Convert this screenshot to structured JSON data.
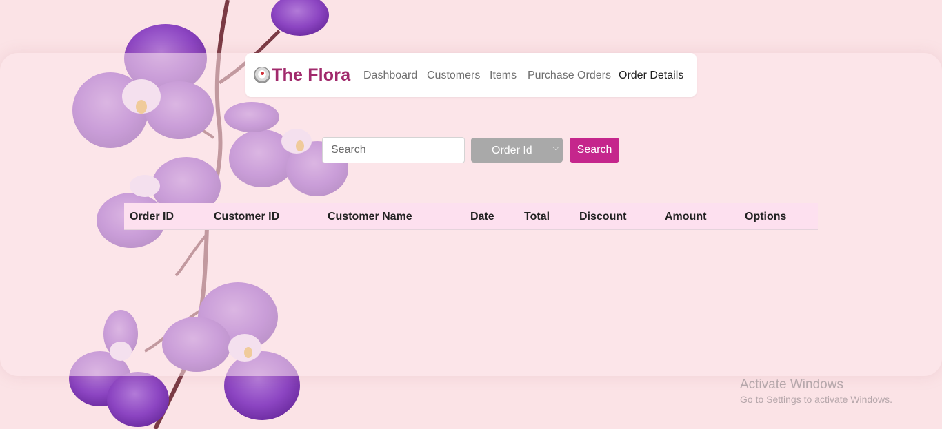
{
  "brand": {
    "name": "The Flora",
    "logo_icon": "flower-logo-icon"
  },
  "nav": {
    "items": [
      {
        "label": "Dashboard",
        "active": false
      },
      {
        "label": "Customers",
        "active": false
      },
      {
        "label": "Items",
        "active": false
      },
      {
        "label": "Purchase Orders",
        "active": false
      },
      {
        "label": "Order Details",
        "active": true
      }
    ]
  },
  "search": {
    "placeholder": "Search",
    "value": "",
    "filter": {
      "selected": "Order Id",
      "icon": "chevron-down-icon"
    },
    "button_label": "Search"
  },
  "table": {
    "columns": [
      "Order ID",
      "Customer ID",
      "Customer Name",
      "Date",
      "Total",
      "Discount",
      "Amount",
      "Options"
    ],
    "rows": []
  },
  "watermark": {
    "title": "Activate Windows",
    "subtitle": "Go to Settings to activate Windows."
  },
  "colors": {
    "brand": "#a12a6c",
    "accent_button": "#c5268c",
    "select_bg": "#a9a9a9",
    "table_header_bg": "#fde0ef",
    "page_bg": "#fbe3e6",
    "orchid": "#8a3bc0"
  }
}
